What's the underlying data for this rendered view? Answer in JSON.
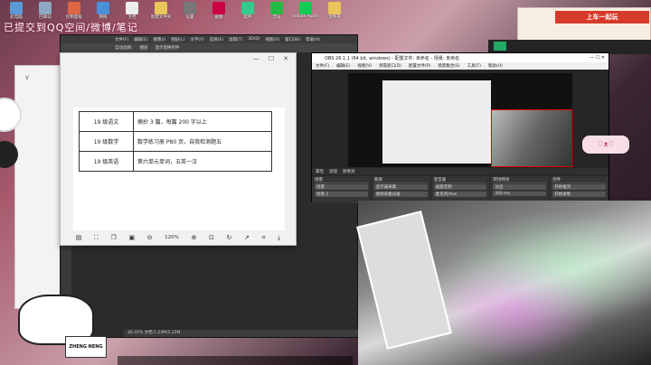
{
  "desktop": {
    "icons": [
      {
        "label": "此电脑",
        "color": "#5b9bd5",
        "icon": "computer-icon"
      },
      {
        "label": "回收站",
        "color": "#8fa9c4",
        "icon": "recycle-bin-icon"
      },
      {
        "label": "控制面板",
        "color": "#d64",
        "icon": "control-panel-icon"
      },
      {
        "label": "网络",
        "color": "#4a90d9",
        "icon": "network-icon"
      },
      {
        "label": "文档",
        "color": "#eee",
        "icon": "document-icon"
      },
      {
        "label": "新建文件夹",
        "color": "#e8c65a",
        "icon": "folder-icon"
      },
      {
        "label": "设置",
        "color": "#777",
        "icon": "settings-icon"
      },
      {
        "label": "截图",
        "color": "#c04",
        "icon": "screenshot-icon"
      },
      {
        "label": "软件",
        "color": "#3c8",
        "icon": "app-icon"
      },
      {
        "label": "音乐",
        "color": "#2b4",
        "icon": "music-icon"
      },
      {
        "label": "Adobe Audition",
        "color": "#1c5",
        "icon": "audition-icon"
      },
      {
        "label": "文件夹",
        "color": "#e8c65a",
        "icon": "folder-icon"
      }
    ],
    "overlay_text": "已提交到QQ空间/微博/笔记"
  },
  "viewer": {
    "zoom": "120%",
    "rows": [
      {
        "subject": "19 级语文",
        "task": "摘抄 3 篇，每篇 200 字以上"
      },
      {
        "subject": "19 级数学",
        "task": "数学练习册 P80 页，自我检测题五"
      },
      {
        "subject": "19 级英语",
        "task": "第六单元单词，五英一汉"
      }
    ]
  },
  "photoshop": {
    "menu": [
      "文件(F)",
      "编辑(E)",
      "图像(I)",
      "图层(L)",
      "文字(Y)",
      "选择(S)",
      "滤镜(T)",
      "3D(D)",
      "视图(V)",
      "窗口(W)",
      "帮助(H)"
    ],
    "options": [
      "自动选择:",
      "图层",
      "显示变换控件"
    ],
    "status": "26.31%    文档:1.23M/1.23M"
  },
  "obs": {
    "title": "OBS 26.1.1 (64 bit, windows) - 配置文件: 未命名 - 场景: 未命名",
    "menu": [
      "文件(F)",
      "编辑(E)",
      "视图(V)",
      "停靠窗口(D)",
      "配置文件(P)",
      "场景集合(S)",
      "工具(T)",
      "帮助(H)"
    ],
    "control_bar": [
      "属性",
      "滤镜",
      "图像源"
    ],
    "panes": [
      {
        "header": "场景",
        "items": [
          "场景",
          "场景 2"
        ]
      },
      {
        "header": "来源",
        "items": [
          "显示器采集",
          "视频采集设备"
        ]
      },
      {
        "header": "混音器",
        "items": [
          "桌面音频",
          "麦克风/Aux"
        ]
      },
      {
        "header": "转场特效",
        "items": [
          "淡出",
          "300 ms"
        ]
      },
      {
        "header": "控件",
        "items": [
          "开始推流",
          "开始录制"
        ]
      }
    ]
  },
  "ad": {
    "banner": "上车一起玩"
  },
  "stickers": {
    "logo": "ZHENG NENG"
  }
}
